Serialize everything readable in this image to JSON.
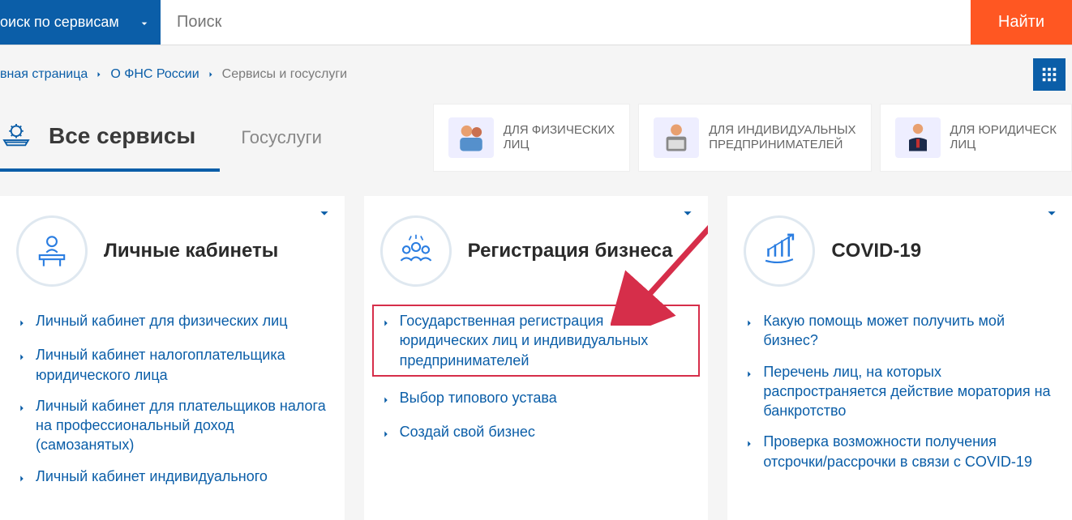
{
  "search": {
    "dropdown_label": "оиск по сервисам",
    "placeholder": "Поиск",
    "button": "Найти"
  },
  "breadcrumb": {
    "items": [
      "вная страница",
      "О ФНС России",
      "Сервисы и госуслуги"
    ]
  },
  "tabs": {
    "main_title": "Все сервисы",
    "gosuslugi": "Госуслуги",
    "audience": [
      {
        "line1": "Для физических",
        "line2": "лиц"
      },
      {
        "line1": "Для индивидуальных",
        "line2": "предпринимателей"
      },
      {
        "line1": "Для юридическ",
        "line2": "лиц"
      }
    ]
  },
  "cards": [
    {
      "title": "Личные кабинеты",
      "links": [
        "Личный кабинет для физических лиц",
        "Личный кабинет налогоплательщика юридического лица",
        "Личный кабинет для плательщиков налога на профессиональный доход (самозанятых)",
        "Личный кабинет индивидуального"
      ]
    },
    {
      "title": "Регистрация бизнеса",
      "links": [
        "Государственная регистрация юридических лиц и индивидуальных предпринимателей",
        "Выбор типового устава",
        "Создай свой бизнес"
      ]
    },
    {
      "title": "COVID-19",
      "links": [
        "Какую помощь может получить мой бизнес?",
        "Перечень лиц, на которых распространяется действие моратория на банкротство",
        "Проверка возможности получения отсрочки/рассрочки в связи с COVID-19"
      ]
    }
  ]
}
